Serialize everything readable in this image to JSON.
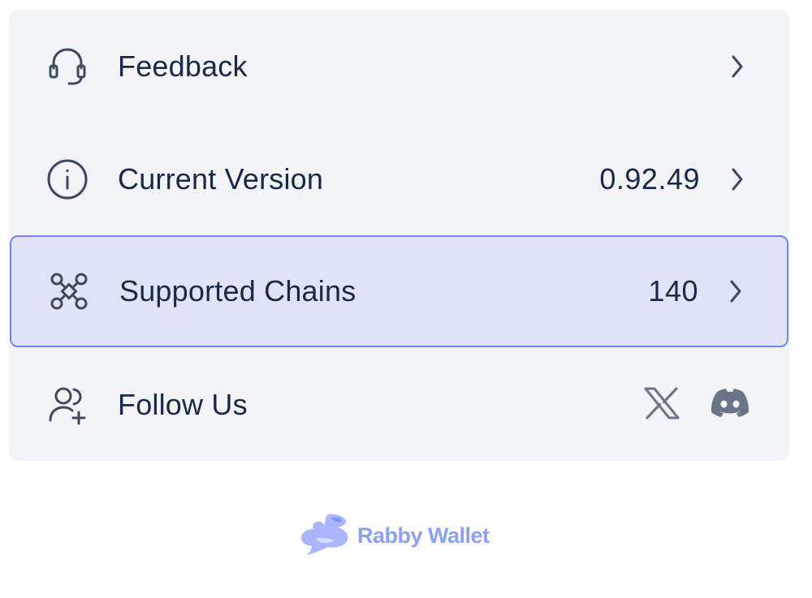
{
  "colors": {
    "card_bg": "#f2f4f7",
    "text": "#192945",
    "icon": "#3e495e",
    "active_bg": "#dfe3f8",
    "active_border": "#7084ff",
    "brand": "#8d9ffc",
    "muted_icon": "#6a7587"
  },
  "menu": {
    "feedback": {
      "label": "Feedback",
      "icon": "headset-icon"
    },
    "version": {
      "label": "Current Version",
      "value": "0.92.49",
      "icon": "info-icon"
    },
    "chains": {
      "label": "Supported Chains",
      "value": "140",
      "icon": "network-icon",
      "active": true
    },
    "follow": {
      "label": "Follow Us",
      "icon": "user-add-icon",
      "socials": [
        "x-icon",
        "discord-icon"
      ]
    }
  },
  "footer": {
    "brand_name": "Rabby Wallet",
    "logo_icon": "rabbit-logo-icon"
  }
}
